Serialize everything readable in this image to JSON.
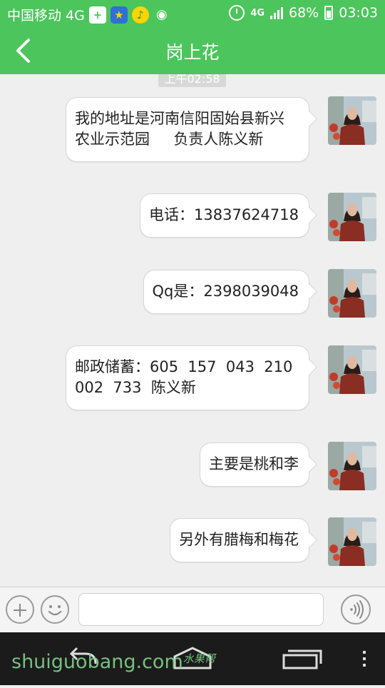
{
  "status_bar": {
    "carrier": "中国移动 4G",
    "network_label": "4G",
    "battery": "68%",
    "time": "03:03"
  },
  "header": {
    "title": "岗上花"
  },
  "timestamp": "上午02:58",
  "messages": [
    {
      "text": "我的地址是河南信阳固始县新兴\n农业示范园     负责人陈义新"
    },
    {
      "text": "电话：13837624718"
    },
    {
      "text": "Qq是：2398039048"
    },
    {
      "text": "邮政储蓄：605  157  043  210\n002  733  陈义新"
    },
    {
      "text": "主要是桃和李"
    },
    {
      "text": "另外有腊梅和梅花"
    }
  ],
  "input": {
    "value": "",
    "placeholder": ""
  },
  "watermark": {
    "main": "shuiguobang.com",
    "sub": "水果帮"
  },
  "colors": {
    "accent": "#4cc55c",
    "nav": "#1b1b1b"
  }
}
